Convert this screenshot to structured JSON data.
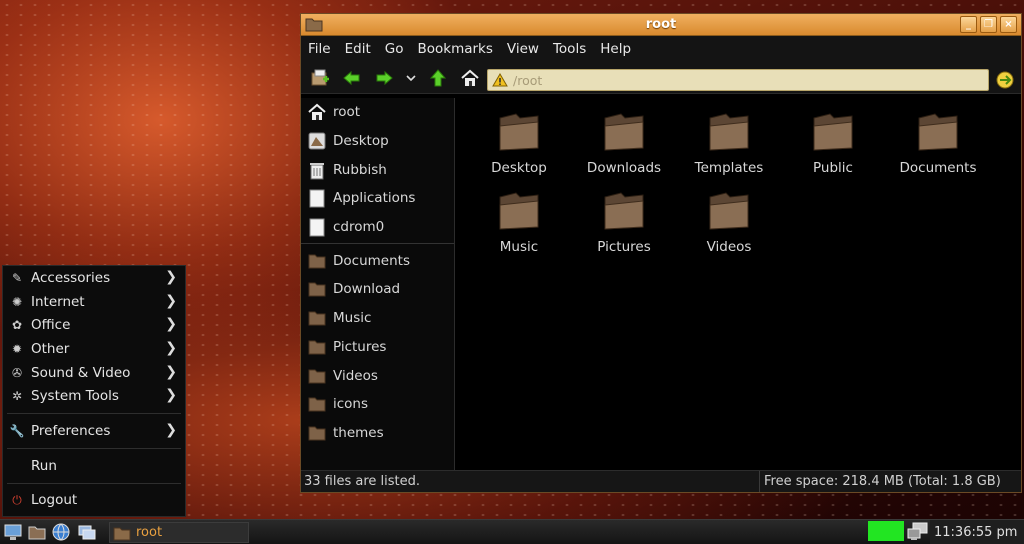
{
  "window": {
    "title": "root",
    "buttons": [
      "_",
      "❐",
      "×"
    ]
  },
  "menubar": {
    "items": [
      "File",
      "Edit",
      "Go",
      "Bookmarks",
      "View",
      "Tools",
      "Help"
    ]
  },
  "toolbar": {
    "location_value": "/root",
    "icons": [
      "new-tab-icon",
      "back-icon",
      "forward-icon",
      "history-dropdown-icon",
      "up-icon",
      "home-icon",
      "go-icon"
    ]
  },
  "sidebar": {
    "places": [
      {
        "label": "root",
        "icon": "home-icon"
      },
      {
        "label": "Desktop",
        "icon": "desktop-icon"
      },
      {
        "label": "Rubbish",
        "icon": "trash-icon"
      },
      {
        "label": "Applications",
        "icon": "applications-icon"
      },
      {
        "label": "cdrom0",
        "icon": "drive-icon"
      }
    ],
    "bookmarks": [
      {
        "label": "Documents"
      },
      {
        "label": "Download"
      },
      {
        "label": "Music"
      },
      {
        "label": "Pictures"
      },
      {
        "label": "Videos"
      },
      {
        "label": "icons"
      },
      {
        "label": "themes"
      }
    ]
  },
  "files": [
    {
      "label": "Desktop"
    },
    {
      "label": "Downloads"
    },
    {
      "label": "Templates"
    },
    {
      "label": "Public"
    },
    {
      "label": "Documents"
    },
    {
      "label": "Music"
    },
    {
      "label": "Pictures"
    },
    {
      "label": "Videos"
    }
  ],
  "statusbar": {
    "left": "33 files are listed.",
    "right": "Free space: 218.4 MB (Total: 1.8 GB)"
  },
  "appmenu": {
    "items": [
      {
        "label": "Accessories",
        "submenu": true,
        "icon": "accessories-icon"
      },
      {
        "label": "Internet",
        "submenu": true,
        "icon": "internet-icon"
      },
      {
        "label": "Office",
        "submenu": true,
        "icon": "office-icon"
      },
      {
        "label": "Other",
        "submenu": true,
        "icon": "other-icon"
      },
      {
        "label": "Sound & Video",
        "submenu": true,
        "icon": "sound-video-icon"
      },
      {
        "label": "System Tools",
        "submenu": true,
        "icon": "system-tools-icon"
      },
      {
        "label": "Preferences",
        "submenu": true,
        "icon": "preferences-icon"
      },
      {
        "label": "Run",
        "submenu": false
      },
      {
        "label": "Logout",
        "submenu": false,
        "icon": "logout-icon"
      }
    ]
  },
  "taskbar": {
    "task_label": "root",
    "clock": "11:36:55 pm",
    "indicator_color": "#22e522"
  },
  "colors": {
    "accent": "#e8a040",
    "titlebar": "#e09a40",
    "location_bg": "#e8dfb8"
  }
}
